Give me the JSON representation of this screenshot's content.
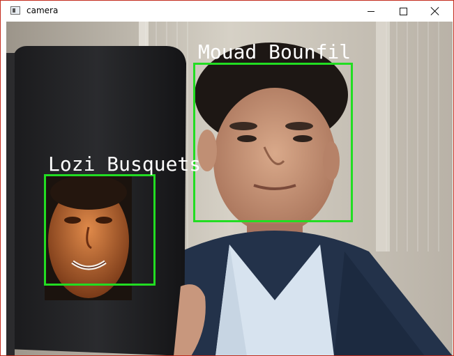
{
  "window": {
    "title": "camera",
    "icon": "camera-window-icon",
    "controls": [
      "minimize-icon",
      "maximize-icon",
      "close-icon"
    ]
  },
  "detections": [
    {
      "label": "Mouad Bounfil"
    },
    {
      "label": "Lozi Busquets"
    }
  ],
  "colors": {
    "box": "#22dd22",
    "label": "#ffffff",
    "window_border": "#c42b1c"
  }
}
